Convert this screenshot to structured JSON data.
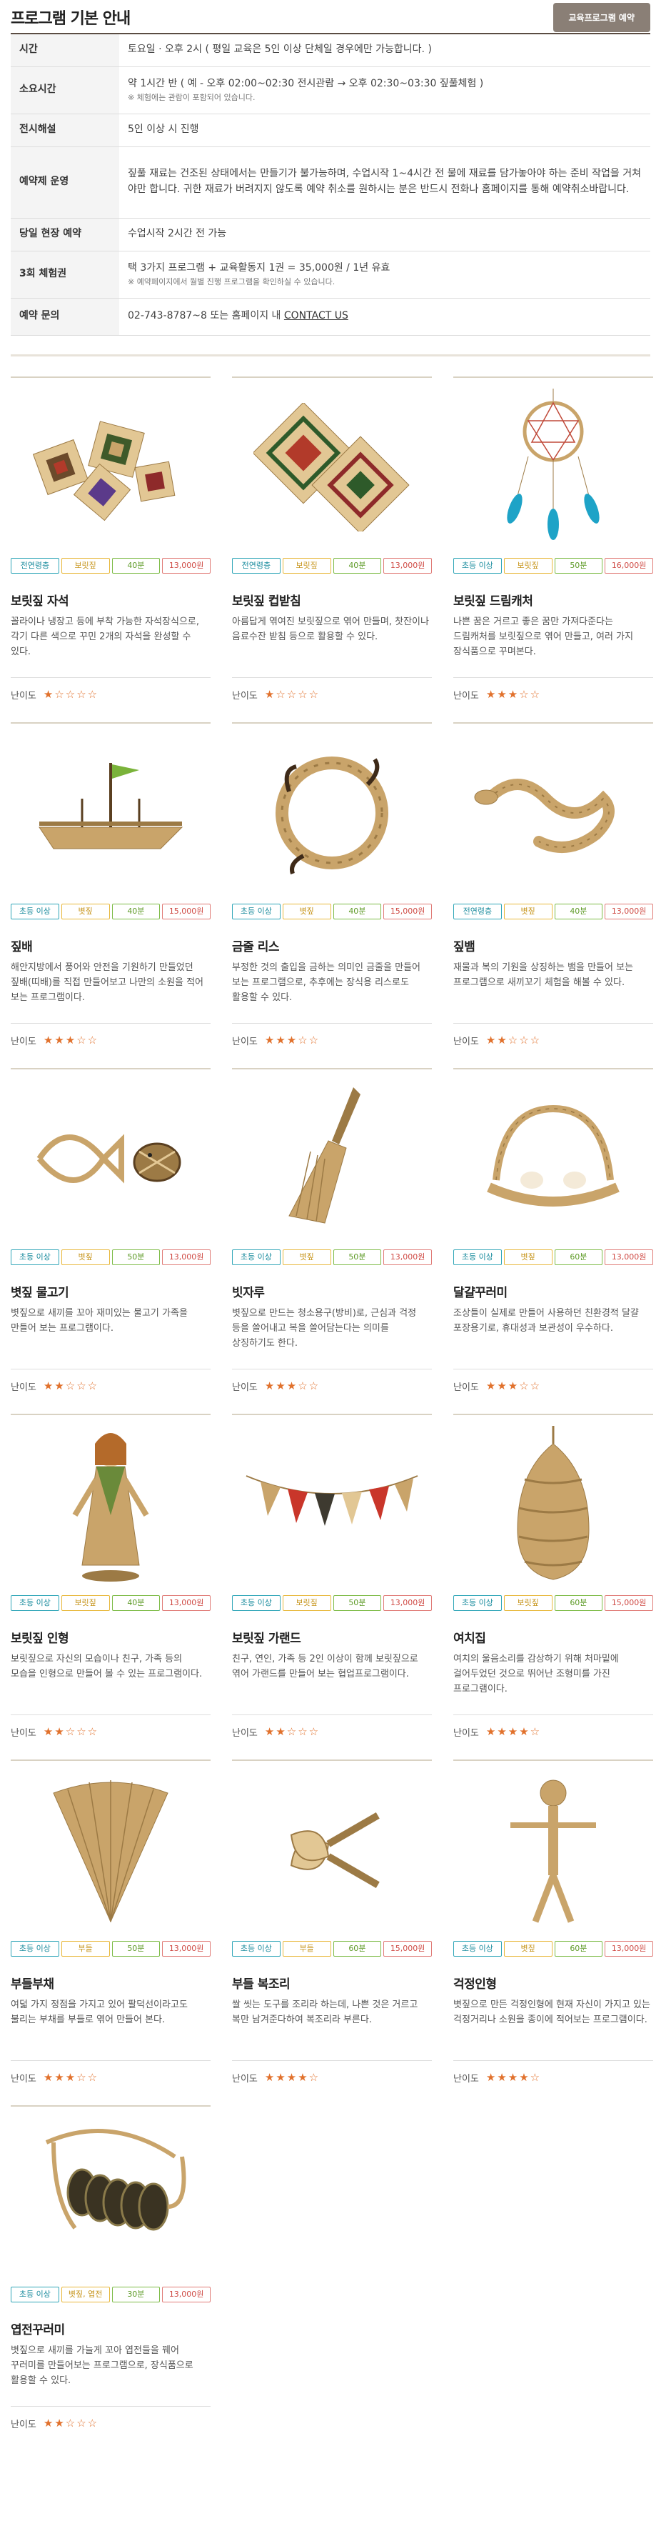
{
  "header": {
    "title": "프로그램 기본 안내",
    "button": "교육프로그램 예약"
  },
  "info": [
    {
      "key": "시간",
      "value": "토요일 · 오후 2시 ( 평일 교육은 5인 이상 단체일 경우에만 가능합니다. )",
      "note": ""
    },
    {
      "key": "소요시간",
      "value": "약 1시간 반 ( 예 - 오후 02:00~02:30 전시관람 → 오후 02:30~03:30 짚풀체험 )",
      "note": "※ 체험에는 관람이 포함되어 있습니다."
    },
    {
      "key": "전시해설",
      "value": "5인 이상 시 진행",
      "note": ""
    },
    {
      "key": "예약제 운영",
      "value": "짚풀 재료는 건조된 상태에서는 만들기가 불가능하며, 수업시작 1~4시간 전 물에 재료를 담가놓아야 하는 준비 작업을 거쳐야만 합니다. 귀한 재료가 버려지지 않도록 예약 취소를 원하시는 분은 반드시 전화나 홈페이지를 통해 예약취소바랍니다.",
      "note": ""
    },
    {
      "key": "당일 현장 예약",
      "value": "수업시작 2시간 전 가능",
      "note": ""
    },
    {
      "key": "3회 체험권",
      "value": "택 3가지 프로그램 + 교육활동지 1권 = 35,000원 / 1년 유효",
      "note": "※ 예약페이지에서 월별 진행 프로그램을 확인하실 수 있습니다."
    },
    {
      "key": "예약 문의",
      "value": "02-743-8787~8 또는 홈페이지 내 ",
      "link": "CONTACT US",
      "note": ""
    }
  ],
  "level_label": "난이도",
  "colors": {
    "cyan": "#30a6b8",
    "yellow": "#e8b83c",
    "green": "#7dbb46",
    "red": "#e07b77",
    "star": "#e1712c"
  },
  "products": [
    {
      "title": "보릿짚 자석",
      "tags": [
        "전연령층",
        "보릿짚",
        "40분",
        "13,000원"
      ],
      "desc": "꼴라이나 냉장고 등에 부착 가능한 자석장식으로, 각기 다른 색으로 꾸민 2개의 자석을 완성할 수 있다.",
      "level": 1,
      "icon": "straw-magnets-image"
    },
    {
      "title": "보릿짚 컵받침",
      "tags": [
        "전연령층",
        "보릿짚",
        "40분",
        "13,000원"
      ],
      "desc": "아름답게 엮여진 보릿짚으로 엮어 만들며, 찻잔이나 음료수잔 받침 등으로 활용할 수 있다.",
      "level": 1,
      "icon": "straw-coaster-image"
    },
    {
      "title": "보릿짚 드림캐처",
      "tags": [
        "초등 이상",
        "보릿짚",
        "50분",
        "16,000원"
      ],
      "desc": "나쁜 꿈은 거르고 좋은 꿈만 가져다준다는 드림캐처를 보릿짚으로 엮어 만들고, 여러 가지 장식품으로 꾸며본다.",
      "level": 3,
      "icon": "dreamcatcher-image"
    },
    {
      "title": "짚배",
      "tags": [
        "초등 이상",
        "볏짚",
        "40분",
        "15,000원"
      ],
      "desc": "해안지방에서 풍어와 안전을 기원하기 만들었던 짚배(띠배)를 직접 만들어보고 나만의 소원을 적어 보는 프로그램이다.",
      "level": 3,
      "icon": "straw-boat-image"
    },
    {
      "title": "금줄 리스",
      "tags": [
        "초등 이상",
        "볏짚",
        "40분",
        "15,000원"
      ],
      "desc": "부정한 것의 출입을 금하는 의미인 금줄을 만들어 보는 프로그램으로, 추후에는 장식용 리스로도 활용할 수 있다.",
      "level": 3,
      "icon": "wreath-image"
    },
    {
      "title": "짚뱀",
      "tags": [
        "전연령층",
        "볏짚",
        "40분",
        "13,000원"
      ],
      "desc": "재물과 복의 기원을 상징하는 뱀을 만들어 보는 프로그램으로 새끼꼬기 체험을 해볼 수 있다.",
      "level": 2,
      "icon": "straw-snake-image"
    },
    {
      "title": "볏짚 물고기",
      "tags": [
        "초등 이상",
        "볏짚",
        "50분",
        "13,000원"
      ],
      "desc": "볏짚으로 새끼를 꼬아 재미있는 물고기 가족을 만들어 보는 프로그램이다.",
      "level": 2,
      "icon": "straw-fish-image"
    },
    {
      "title": "빗자루",
      "tags": [
        "초등 이상",
        "볏짚",
        "50분",
        "13,000원"
      ],
      "desc": "볏짚으로 만드는 청소용구(방비)로, 근심과 걱정 등을 쓸어내고 복을 쓸어담는다는 의미를 상징하기도 한다.",
      "level": 3,
      "icon": "broom-image"
    },
    {
      "title": "달걀꾸러미",
      "tags": [
        "초등 이상",
        "볏짚",
        "60분",
        "13,000원"
      ],
      "desc": "조상들이 실제로 만들어 사용하던 친환경적 달걀 포장용기로, 휴대성과 보관성이 우수하다.",
      "level": 3,
      "icon": "egg-holder-image"
    },
    {
      "title": "보릿짚 인형",
      "tags": [
        "초등 이상",
        "보릿짚",
        "40분",
        "13,000원"
      ],
      "desc": "보릿짚으로 자신의 모습이나 친구, 가족 등의 모습을 인형으로 만들어 볼 수 있는 프로그램이다.",
      "level": 2,
      "icon": "straw-doll-image"
    },
    {
      "title": "보릿짚 가랜드",
      "tags": [
        "초등 이상",
        "보릿짚",
        "50분",
        "13,000원"
      ],
      "desc": "친구, 연인, 가족 등 2인 이상이 함께 보릿짚으로 엮어 가랜드를 만들어 보는 협업프로그램이다.",
      "level": 2,
      "icon": "garland-image"
    },
    {
      "title": "여치집",
      "tags": [
        "초등 이상",
        "보릿짚",
        "60분",
        "15,000원"
      ],
      "desc": "여치의 울음소리를 감상하기 위해 처마밑에 걸어두었던 것으로 뛰어난 조형미를 가진 프로그램이다.",
      "level": 4,
      "icon": "cricket-house-image"
    },
    {
      "title": "부들부채",
      "tags": [
        "초등 이상",
        "부들",
        "50분",
        "13,000원"
      ],
      "desc": "여덟 가지 정점을 가지고 있어 팔덕선이라고도 불리는 부채를 부들로 엮어 만들어 본다.",
      "level": 3,
      "icon": "cattail-fan-image"
    },
    {
      "title": "부들 복조리",
      "tags": [
        "초등 이상",
        "부들",
        "60분",
        "15,000원"
      ],
      "desc": "쌀 씻는 도구를 조리라 하는데, 나쁜 것은 거르고 복만 남겨준다하여 복조리라 부른다.",
      "level": 4,
      "icon": "bokjori-image"
    },
    {
      "title": "걱정인형",
      "tags": [
        "초등 이상",
        "볏짚",
        "60분",
        "13,000원"
      ],
      "desc": "볏짚으로 만든 걱정인형에 현재 자신이 가지고 있는 걱정거리나 소원을 종이에 적어보는 프로그램이다.",
      "level": 4,
      "icon": "worry-doll-image"
    },
    {
      "title": "엽전꾸러미",
      "tags": [
        "초등 이상",
        "볏짚, 엽전",
        "30분",
        "13,000원"
      ],
      "desc": "볏짚으로 새끼를 가늘게 꼬아 엽전들을 꿰어 꾸러미를 만들어보는 프로그램으로, 장식품으로 활용할 수 있다.",
      "level": 2,
      "icon": "coin-string-image"
    }
  ]
}
